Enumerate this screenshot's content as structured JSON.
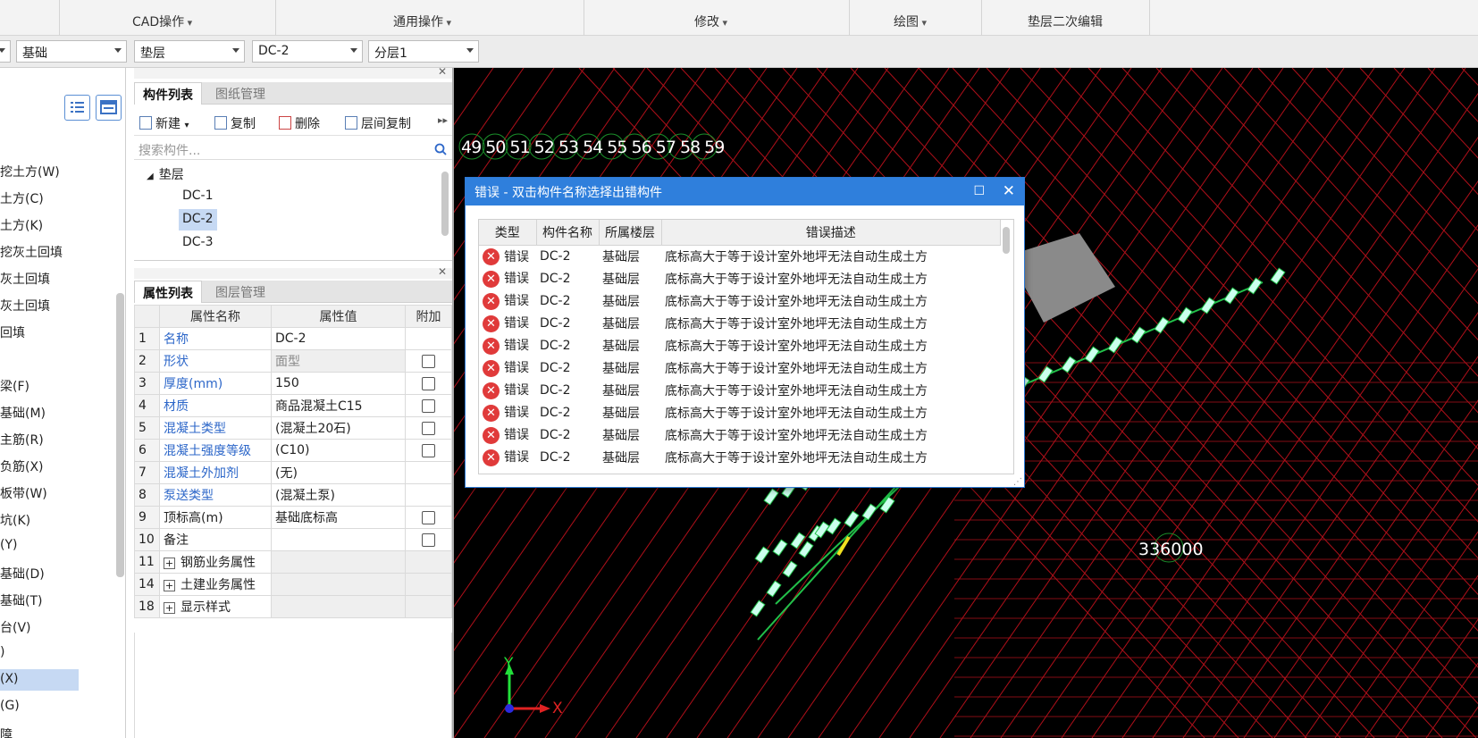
{
  "ribbon": {
    "groups": [
      "CAD操作",
      "通用操作",
      "修改",
      "绘图",
      "垫层二次编辑"
    ]
  },
  "selectors": {
    "floor": "基础",
    "category": "垫层",
    "component": "DC-2",
    "layer": "分层1"
  },
  "left_panel": {
    "items": [
      "挖土方(W)",
      "土方(C)",
      "土方(K)",
      "挖灰土回填",
      "灰土回填",
      "灰土回填",
      "回填",
      "",
      "梁(F)",
      "基础(M)",
      "主筋(R)",
      "负筋(X)",
      "板带(W)",
      "坑(K)",
      "(Y)",
      "基础(D)",
      "基础(T)",
      "台(V)",
      ")",
      "(X)",
      "(G)",
      "障"
    ],
    "selected_index": 19
  },
  "component_panel": {
    "tabs": [
      "构件列表",
      "图纸管理"
    ],
    "toolbar": [
      "新建",
      "复制",
      "删除",
      "层间复制"
    ],
    "search_placeholder": "搜索构件...",
    "tree_root": "垫层",
    "tree_items": [
      "DC-1",
      "DC-2",
      "DC-3"
    ],
    "selected_item": "DC-2"
  },
  "property_panel": {
    "tabs": [
      "属性列表",
      "图层管理"
    ],
    "headers": [
      "属性名称",
      "属性值",
      "附加"
    ],
    "rows": [
      {
        "num": "1",
        "name": "名称",
        "value": "DC-2"
      },
      {
        "num": "2",
        "name": "形状",
        "value": "面型"
      },
      {
        "num": "3",
        "name": "厚度(mm)",
        "value": "150"
      },
      {
        "num": "4",
        "name": "材质",
        "value": "商品混凝土C15"
      },
      {
        "num": "5",
        "name": "混凝土类型",
        "value": "(混凝土20石)"
      },
      {
        "num": "6",
        "name": "混凝土强度等级",
        "value": "(C10)"
      },
      {
        "num": "7",
        "name": "混凝土外加剂",
        "value": "(无)"
      },
      {
        "num": "8",
        "name": "泵送类型",
        "value": "(混凝土泵)"
      },
      {
        "num": "9",
        "name": "顶标高(m)",
        "value": "基础底标高"
      },
      {
        "num": "10",
        "name": "备注",
        "value": ""
      },
      {
        "num": "11",
        "name": "钢筋业务属性",
        "value": ""
      },
      {
        "num": "14",
        "name": "土建业务属性",
        "value": ""
      },
      {
        "num": "18",
        "name": "显示样式",
        "value": ""
      }
    ]
  },
  "canvas": {
    "axis_numbers": "49 50 51 52 53 54 55 56 57 58 59",
    "coordinate_label": "336000",
    "axis_x": "X",
    "axis_y": "Y"
  },
  "dialog": {
    "title": "错误 - 双击构件名称选择出错构件",
    "headers": [
      "类型",
      "构件名称",
      "所属楼层",
      "错误描述"
    ],
    "rows": [
      {
        "type": "错误",
        "name": "DC-2",
        "floor": "基础层",
        "desc": "底标高大于等于设计室外地坪无法自动生成土方"
      },
      {
        "type": "错误",
        "name": "DC-2",
        "floor": "基础层",
        "desc": "底标高大于等于设计室外地坪无法自动生成土方"
      },
      {
        "type": "错误",
        "name": "DC-2",
        "floor": "基础层",
        "desc": "底标高大于等于设计室外地坪无法自动生成土方"
      },
      {
        "type": "错误",
        "name": "DC-2",
        "floor": "基础层",
        "desc": "底标高大于等于设计室外地坪无法自动生成土方"
      },
      {
        "type": "错误",
        "name": "DC-2",
        "floor": "基础层",
        "desc": "底标高大于等于设计室外地坪无法自动生成土方"
      },
      {
        "type": "错误",
        "name": "DC-2",
        "floor": "基础层",
        "desc": "底标高大于等于设计室外地坪无法自动生成土方"
      },
      {
        "type": "错误",
        "name": "DC-2",
        "floor": "基础层",
        "desc": "底标高大于等于设计室外地坪无法自动生成土方"
      },
      {
        "type": "错误",
        "name": "DC-2",
        "floor": "基础层",
        "desc": "底标高大于等于设计室外地坪无法自动生成土方"
      },
      {
        "type": "错误",
        "name": "DC-2",
        "floor": "基础层",
        "desc": "底标高大于等于设计室外地坪无法自动生成土方"
      },
      {
        "type": "错误",
        "name": "DC-2",
        "floor": "基础层",
        "desc": "底标高大于等于设计室外地坪无法自动生成土方"
      }
    ]
  },
  "colors": {
    "accent": "#2f7fdc",
    "grid": "#b0101a",
    "error": "#e03a3a",
    "canvas_bg": "#000000"
  }
}
